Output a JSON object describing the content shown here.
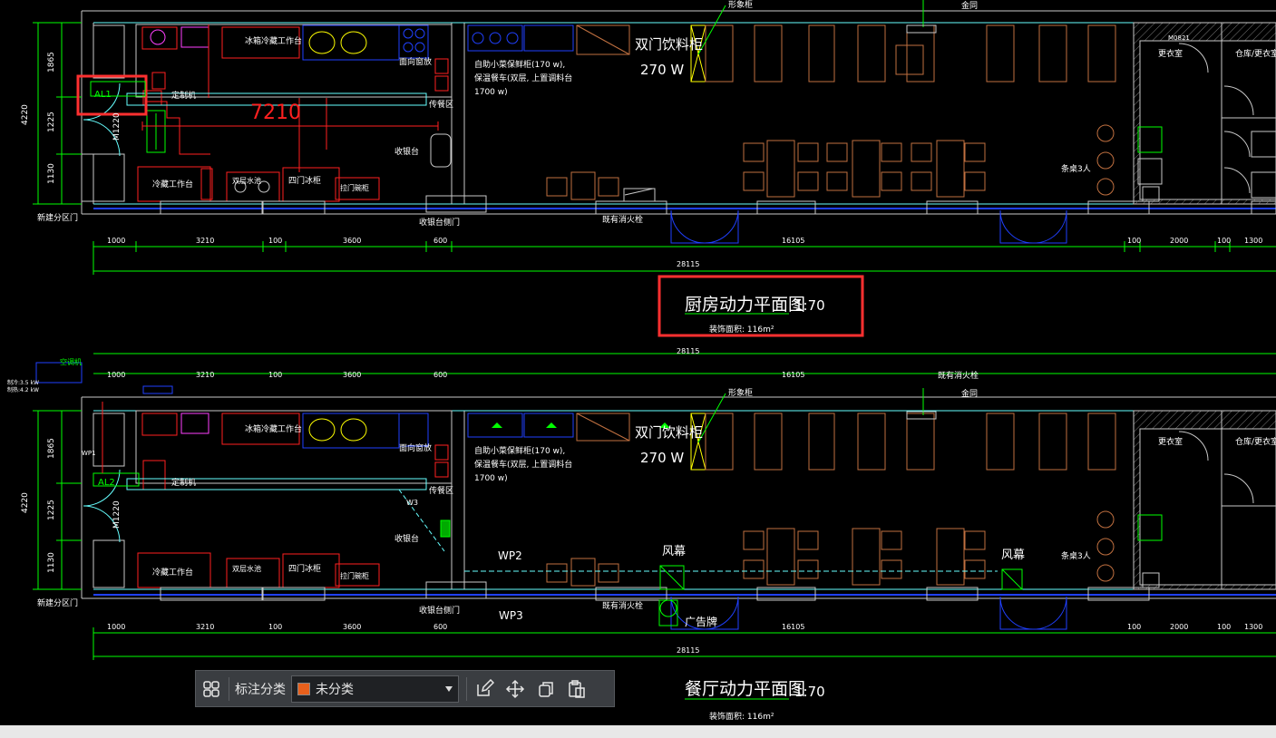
{
  "plan1": {
    "title": "厨房动力平面图",
    "scale": "1:70",
    "subtitle": "装饰面积: 116m²",
    "dim_total": "28115",
    "dims": [
      "1000",
      "3210",
      "100",
      "3600",
      "600",
      "16105",
      "100",
      "2000",
      "100",
      "1300"
    ],
    "big_dim": "7210",
    "vert_dims": [
      "4220",
      "1865",
      "1225",
      "1130"
    ],
    "door": "M1220",
    "panel": "AL1",
    "labels": {
      "fridge_bench": "冰箱冷藏工作台",
      "fridge_bench2": "冷藏工作台",
      "double_sink": "双层水池",
      "four_door": "四门冰柜",
      "low_cabinet": "拉门碗柜",
      "window": "面向窗放",
      "pass": "传餐区",
      "cashier": "收银台",
      "cashier_door": "收银台侧门",
      "hood": "定制机",
      "new_door": "新建分区门",
      "buffet": "自助小菜保鲜柜(170 w),\n保温餐车(双层, 上置调料台\n1700 w)",
      "double_bev": "双门饮料柜",
      "bev_watt": "270 W",
      "display": "形象柜",
      "seats": "条桌3人",
      "changing": "更衣室",
      "store": "仓库/更衣室",
      "fire": "既有消火栓",
      "gold": "金同",
      "m0821": "M0821"
    }
  },
  "plan2": {
    "title": "餐厅动力平面图",
    "scale": "1:70",
    "subtitle": "装饰面积: 116m²",
    "panel": "AL2",
    "wp1": "WP1",
    "wp2": "WP2",
    "wp3": "WP3",
    "w3": "W3",
    "fan1": "风幕",
    "fan2": "风幕",
    "ad": "广告牌",
    "ac": "空调机",
    "ac_spec": "制冷:3.5 kW\n制热:4.2 kW"
  },
  "toolbar": {
    "category_label": "标注分类",
    "category_value": "未分类",
    "category_color": "#e8601c"
  },
  "colors": {
    "wall": "#c8c8c8",
    "dim": "#00ff00",
    "equip": "#ff2020",
    "furniture": "#c07040",
    "elec": "#2040ff",
    "highlight": "#ff3030"
  }
}
